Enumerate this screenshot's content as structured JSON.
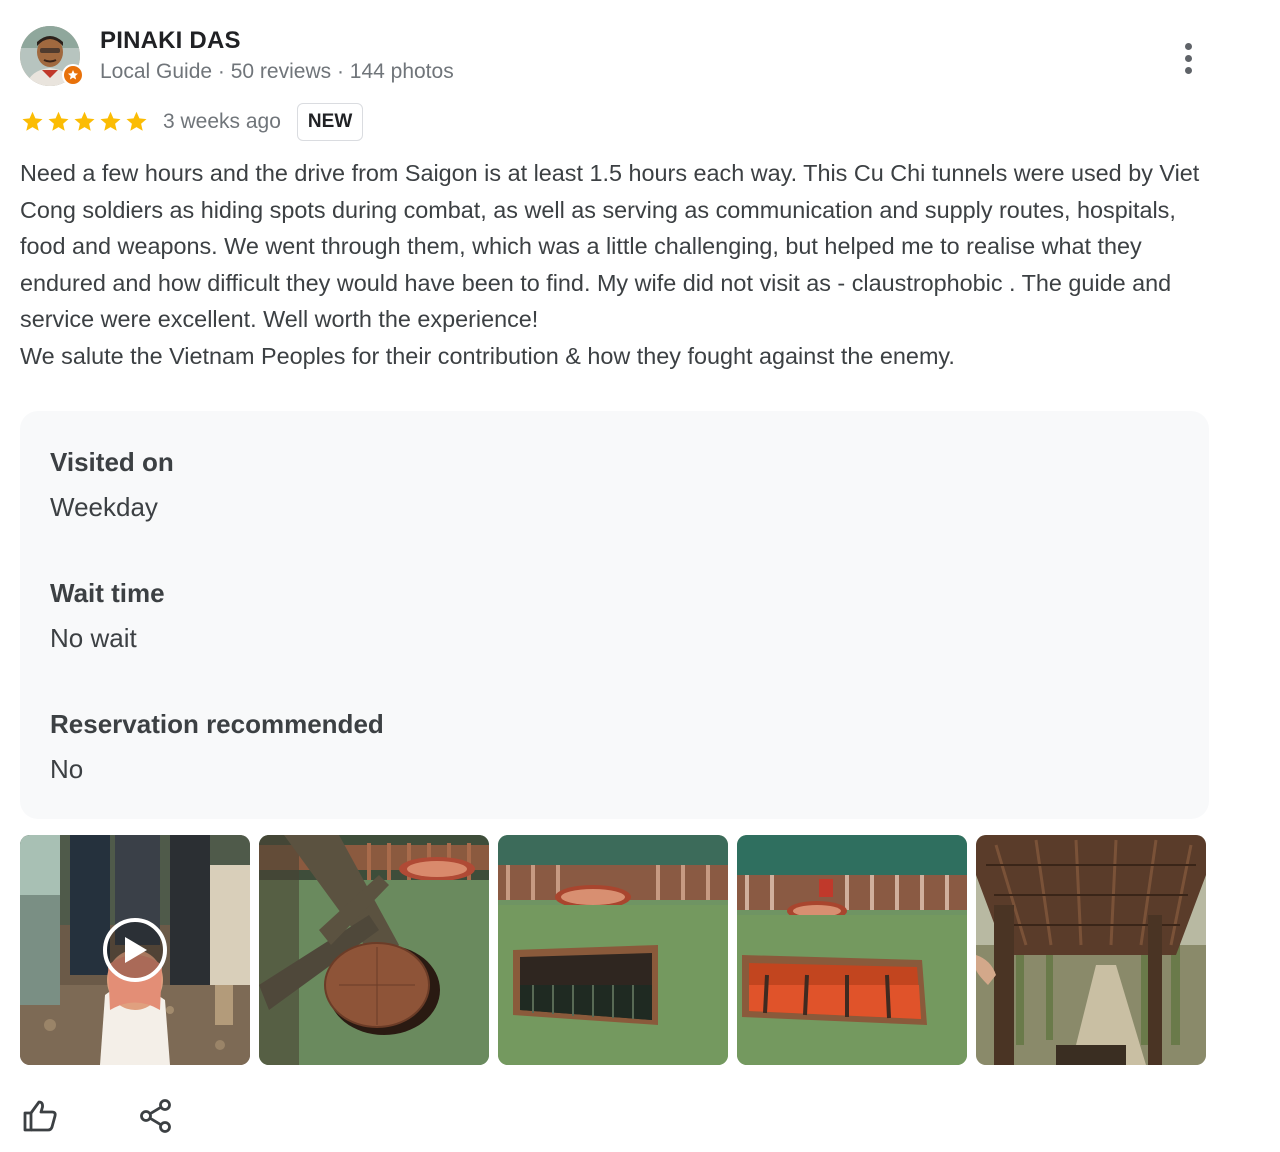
{
  "author": {
    "name": "PINAKI DAS",
    "meta": "Local Guide · 50 reviews · 144 photos",
    "avatar_icon": "user-avatar",
    "badge_icon": "local-guide-star-icon"
  },
  "rating": {
    "stars": 5,
    "max_stars": 5,
    "star_color": "#fbbc04",
    "time_ago": "3 weeks ago",
    "badge": "NEW"
  },
  "review": {
    "paragraphs": [
      "Need a few hours and the drive from Saigon is at least 1.5 hours each way. This Cu Chi tunnels were used by Viet Cong soldiers as hiding spots during combat, as well as serving as communication and supply routes, hospitals, food and weapons. We went through them, which was a little challenging, but helped me to realise what they endured and how difficult they would have been to find. My wife did not visit as - claustrophobic . The guide and service were excellent. Well worth the experience!",
      "We salute the Vietnam Peoples for their contribution & how they fought against the enemy."
    ]
  },
  "details": [
    {
      "label": "Visited on",
      "value": "Weekday"
    },
    {
      "label": "Wait time",
      "value": "No wait"
    },
    {
      "label": "Reservation recommended",
      "value": "No"
    }
  ],
  "photos": [
    {
      "kind": "video",
      "icon": "play-icon"
    },
    {
      "kind": "photo"
    },
    {
      "kind": "photo"
    },
    {
      "kind": "photo"
    },
    {
      "kind": "photo"
    }
  ],
  "actions": {
    "like_icon": "thumbs-up-icon",
    "share_icon": "share-icon",
    "more_icon": "more-vert-icon"
  },
  "colors": {
    "text_primary": "#202124",
    "text_body": "#3c4043",
    "text_secondary": "#70757a",
    "card_bg": "#f8f9fa",
    "badge_orange": "#e8710a"
  }
}
